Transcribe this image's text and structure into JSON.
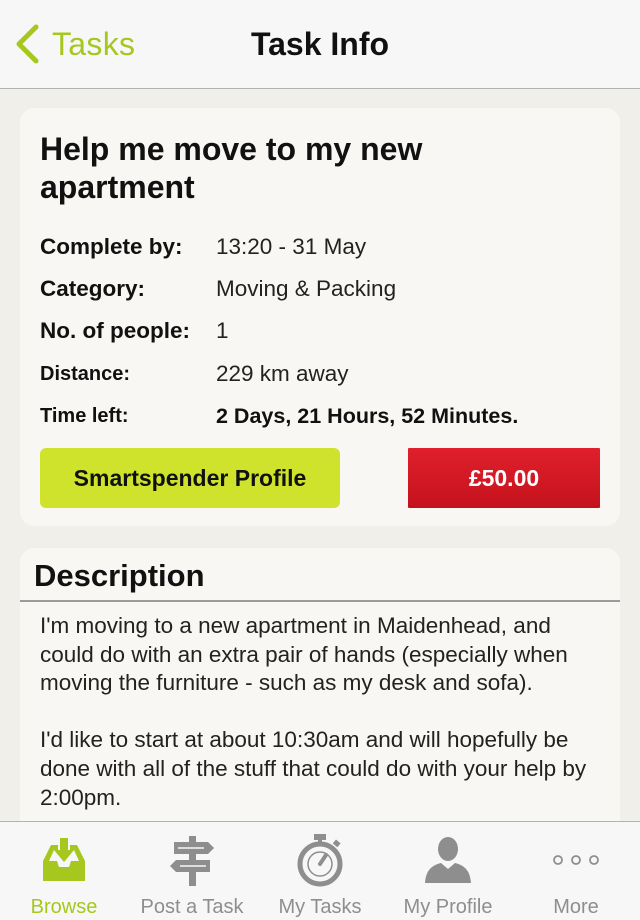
{
  "nav": {
    "back_label": "Tasks",
    "title": "Task Info"
  },
  "task": {
    "title": "Help me move to my new apartment",
    "rows": [
      {
        "label": "Complete by:",
        "value": "13:20 - 31 May"
      },
      {
        "label": "Category:",
        "value": "Moving & Packing"
      },
      {
        "label": "No. of people:",
        "value": "1"
      },
      {
        "label": "Distance:",
        "value": "229 km away"
      },
      {
        "label": "Time left:",
        "value": "2 Days, 21 Hours, 52 Minutes."
      }
    ],
    "profile_button": "Smartspender Profile",
    "price_button": "£50.00"
  },
  "description": {
    "header": "Description",
    "text": "I'm moving to a new apartment in Maidenhead, and could do with an extra pair of hands (especially when moving the furniture - such as my desk and sofa).\n\nI'd like to start at about 10:30am and will hopefully be done with all of the stuff that could do with your help by 2:00pm."
  },
  "tabbar": {
    "active": "Browse",
    "tabs": [
      {
        "label": "Browse",
        "icon": "inbox-download-icon"
      },
      {
        "label": "Post a Task",
        "icon": "signpost-icon"
      },
      {
        "label": "My Tasks",
        "icon": "stopwatch-icon"
      },
      {
        "label": "My Profile",
        "icon": "person-icon"
      },
      {
        "label": "More",
        "icon": "more-dots-icon"
      }
    ]
  },
  "colors": {
    "accent": "#a6c81e",
    "profile_button": "#cfe32d",
    "price_button": "#d0161f",
    "background": "#f0efea"
  }
}
